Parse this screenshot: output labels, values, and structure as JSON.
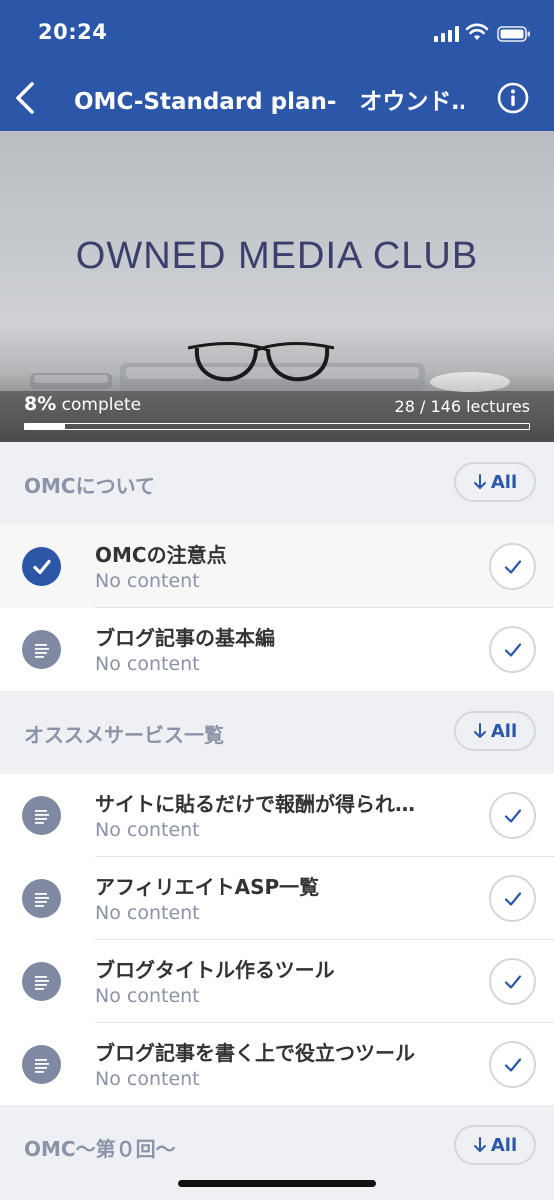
{
  "status_bar": {
    "time": "20:24"
  },
  "nav": {
    "title": "OMC-Standard plan-　オウンド…"
  },
  "hero": {
    "title": "OWNED MEDIA CLUB",
    "percent": "8%",
    "percent_suffix": "complete",
    "lectures": "28 / 146 lectures",
    "progress": 0.08
  },
  "sections": [
    {
      "title": "OMCについて",
      "all_label": "All",
      "items": [
        {
          "title": "OMCの注意点",
          "subtitle": "No content",
          "completed": true
        },
        {
          "title": "ブログ記事の基本編",
          "subtitle": "No content",
          "completed": false
        }
      ]
    },
    {
      "title": "オススメサービス一覧",
      "all_label": "All",
      "items": [
        {
          "title": "サイトに貼るだけで報酬が得られ…",
          "subtitle": "No content",
          "completed": false
        },
        {
          "title": "アフィリエイトASP一覧",
          "subtitle": "No content",
          "completed": false
        },
        {
          "title": "ブログタイトル作るツール",
          "subtitle": "No content",
          "completed": false
        },
        {
          "title": "ブログ記事を書く上で役立つツール",
          "subtitle": "No content",
          "completed": false
        }
      ]
    },
    {
      "title": "OMC〜第０回〜",
      "all_label": "All",
      "items": []
    }
  ],
  "colors": {
    "brand": "#2c57a8",
    "muted": "#8b93a6",
    "lead_icon": "#7f8aa2"
  },
  "icons": {
    "back": "chevron-left-icon",
    "info": "info-circle-icon",
    "lead_done": "checkmark-circle-icon",
    "lead_pending": "text-lines-icon",
    "row_action": "checkmark-icon",
    "all": "arrow-down-icon"
  }
}
